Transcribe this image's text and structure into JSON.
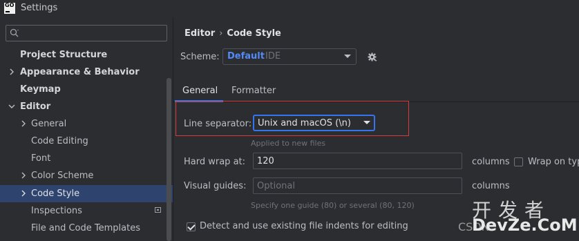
{
  "window": {
    "app_icon": "GO",
    "title": "Settings"
  },
  "sidebar": {
    "search": {
      "value": "",
      "placeholder": ""
    },
    "items": [
      {
        "label": "Project Structure"
      },
      {
        "label": "Appearance & Behavior"
      },
      {
        "label": "Keymap"
      },
      {
        "label": "Editor"
      },
      {
        "label": "General"
      },
      {
        "label": "Code Editing"
      },
      {
        "label": "Font"
      },
      {
        "label": "Color Scheme"
      },
      {
        "label": "Code Style"
      },
      {
        "label": "Inspections"
      },
      {
        "label": "File and Code Templates"
      }
    ],
    "selected_item": "Code Style"
  },
  "main": {
    "breadcrumb": [
      "Editor",
      "Code Style"
    ],
    "scheme": {
      "label": "Scheme:",
      "name": "Default",
      "type": "IDE"
    },
    "tabs": [
      {
        "label": "General"
      },
      {
        "label": "Formatter"
      }
    ],
    "active_tab": "General",
    "line_separator": {
      "label": "Line separator:",
      "value": "Unix and macOS (\\n)",
      "hint": "Applied to new files"
    },
    "hard_wrap": {
      "label": "Hard wrap at:",
      "value": "120",
      "unit": "columns",
      "wrap_on_typing_label": "Wrap on typ",
      "wrap_on_typing_checked": false
    },
    "visual_guides": {
      "label": "Visual guides:",
      "placeholder": "Optional",
      "unit": "columns",
      "hint": "Specify one guide (80) or several (80, 120)"
    },
    "detect_indents": {
      "label": "Detect and use existing file indents for editing",
      "checked": true
    }
  },
  "watermark": {
    "zh": "开发者",
    "csdn": "CSDN",
    "en": "DevZe.CoM"
  },
  "colors": {
    "accent": "#3574f0",
    "highlight_box": "#d93a3a",
    "selected_bg": "#2e436e",
    "scheme_name": "#548af7",
    "background": "#2b2d30"
  }
}
